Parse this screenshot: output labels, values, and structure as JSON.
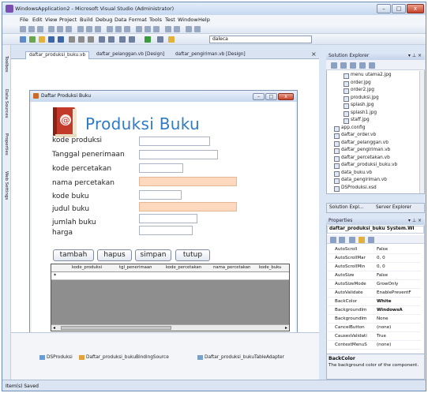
{
  "window": {
    "title": "WindowsApplication2 - Microsoft Visual Studio (Administrator)",
    "min": "–",
    "max": "□",
    "close": "x"
  },
  "menu": [
    "File",
    "Edit",
    "View",
    "Project",
    "Build",
    "Debug",
    "Data",
    "Format",
    "Tools",
    "Test",
    "Window",
    "Help"
  ],
  "toolbar": {
    "search_value": "daleca"
  },
  "left_strip": [
    "Toolbox",
    "Data Sources",
    "Properties",
    "Web Settings"
  ],
  "doc_tabs": [
    "daftar_produksi_buku.vb",
    "daftar_pelanggan.vb [Design]",
    "daftar_pengiriman.vb [Design]"
  ],
  "form": {
    "title": "Daftar Produksi Buku",
    "brand": "Produksi Buku",
    "fields": [
      {
        "label": "kode produksi"
      },
      {
        "label": "Tanggal penerimaan"
      },
      {
        "label": "kode percetakan"
      },
      {
        "label": "nama percetakan"
      },
      {
        "label": "kode buku"
      },
      {
        "label": "judul buku"
      },
      {
        "label": "jumlah buku"
      },
      {
        "label": "harga"
      }
    ],
    "buttons": {
      "tambah": "tambah",
      "hapus": "hapus",
      "simpan": "simpan",
      "tutup": "tutup"
    },
    "grid": {
      "columns": [
        "kode_produksi",
        "tgl_penerimaan",
        "kode_percetakan",
        "nama_percetakan",
        "kode_buku"
      ],
      "new_row_marker": "*"
    }
  },
  "tray": [
    "DSProduksi",
    "Daftar_produksi_bukuBindingSource",
    "Daftar_produksi_bukuTableAdapter"
  ],
  "solution_explorer": {
    "title": "Solution Explorer",
    "items": [
      "menu utama2.jpg",
      "order.jpg",
      "order2.jpg",
      "produksi.jpg",
      "splash.jpg",
      "splash1.jpg",
      "staff.jpg",
      "app.config",
      "daftar_order.vb",
      "daftar_pelanggan.vb",
      "daftar_pengiriman.vb",
      "daftar_percetakan.vb",
      "daftar_produksi_buku.vb",
      "data_buku.vb",
      "data_pengiriman.vb",
      "DSProduksi.xsd"
    ],
    "tabs": [
      "Solution Expl...",
      "Server Explorer"
    ]
  },
  "properties": {
    "title": "Properties",
    "object": "daftar_produksi_buku System.Wi",
    "rows": [
      {
        "n": "AutoScroll",
        "v": "False"
      },
      {
        "n": "AutoScrollMar",
        "v": "0, 0"
      },
      {
        "n": "AutoScrollMin",
        "v": "0, 0"
      },
      {
        "n": "AutoSize",
        "v": "False"
      },
      {
        "n": "AutoSizeMode",
        "v": "GrowOnly"
      },
      {
        "n": "AutoValidate",
        "v": "EnablePreventF"
      },
      {
        "n": "BackColor",
        "v": "White"
      },
      {
        "n": "BackgroundIm",
        "v": "WindowsA"
      },
      {
        "n": "BackgroundIm",
        "v": "None"
      },
      {
        "n": "CancelButton",
        "v": "(none)"
      },
      {
        "n": "CausesValidati",
        "v": "True"
      },
      {
        "n": "ContextMenuS",
        "v": "(none)"
      }
    ],
    "desc_title": "BackColor",
    "desc_text": "The background color of the component."
  },
  "status": "Item(s) Saved"
}
